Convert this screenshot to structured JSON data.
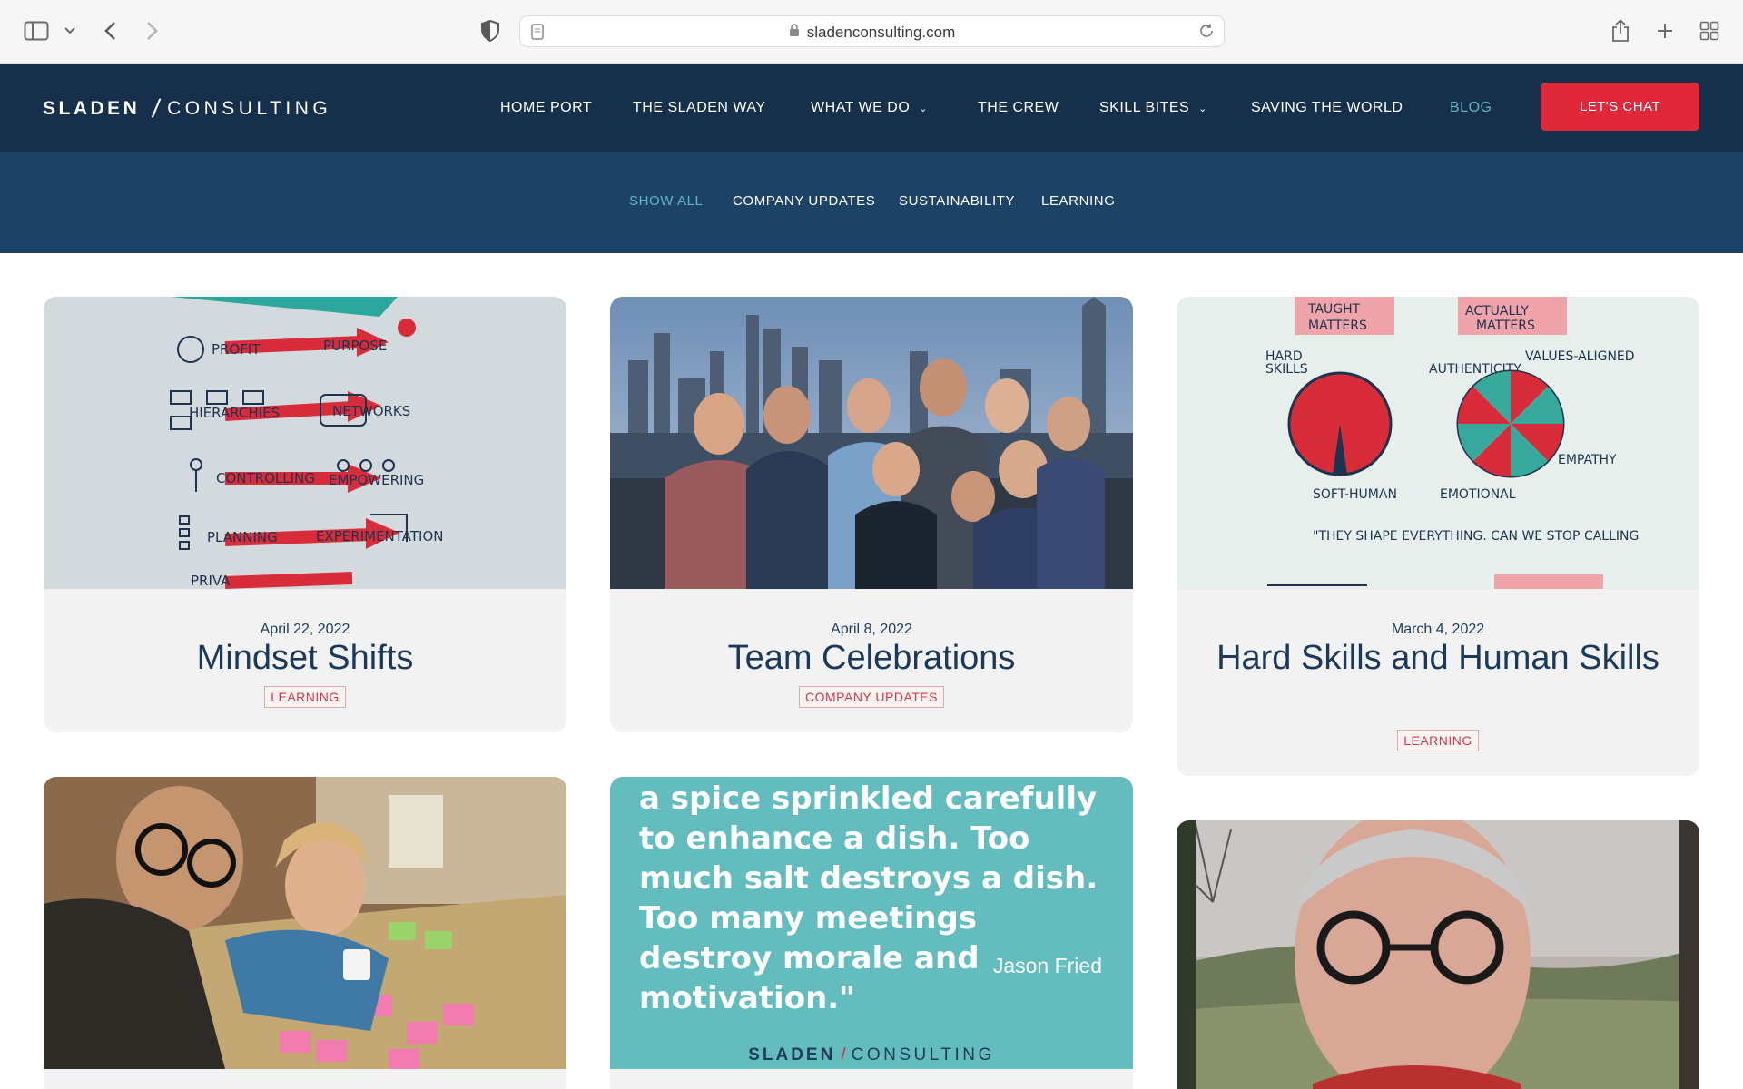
{
  "browser": {
    "url": "sladenconsulting.com"
  },
  "site": {
    "logo_primary": "SLADEN",
    "logo_secondary": "CONSULTING",
    "nav": [
      {
        "label": "HOME PORT",
        "has_dropdown": false,
        "active": false
      },
      {
        "label": "THE SLADEN WAY",
        "has_dropdown": false,
        "active": false
      },
      {
        "label": "WHAT WE DO",
        "has_dropdown": true,
        "active": false
      },
      {
        "label": "THE CREW",
        "has_dropdown": false,
        "active": false
      },
      {
        "label": "SKILL BITES",
        "has_dropdown": true,
        "active": false
      },
      {
        "label": "SAVING THE WORLD",
        "has_dropdown": false,
        "active": false
      },
      {
        "label": "BLOG",
        "has_dropdown": false,
        "active": true
      }
    ],
    "cta_label": "LET'S CHAT",
    "accent_color": "#e0283a",
    "header_color": "#16304b"
  },
  "filters": [
    {
      "label": "SHOW ALL",
      "active": true
    },
    {
      "label": "COMPANY UPDATES",
      "active": false
    },
    {
      "label": "SUSTAINABILITY",
      "active": false
    },
    {
      "label": "LEARNING",
      "active": false
    }
  ],
  "posts": [
    {
      "date": "April 22, 2022",
      "title": "Mindset Shifts",
      "tag": "LEARNING",
      "image": "sketchnote-mindset-shifts"
    },
    {
      "date": "April 8, 2022",
      "title": "Team Celebrations",
      "tag": "COMPANY UPDATES",
      "image": "team-group-photo-city-skyline"
    },
    {
      "date": "March 4, 2022",
      "title": "Hard Skills and Human Skills",
      "tag": "LEARNING",
      "image": "sketchnote-hard-skills-pie-charts"
    },
    {
      "image": "two-people-with-sticky-notes-photo"
    },
    {
      "image": "quote-card",
      "quote": "a spice sprinkled carefully to enhance a dish. Too much salt destroys a dish. Too many meetings destroy morale and motivation.\"",
      "quote_author": "Jason Fried",
      "quote_logo_primary": "SLADEN",
      "quote_logo_secondary": "CONSULTING"
    },
    {
      "image": "man-with-glasses-outdoor-photo"
    }
  ]
}
